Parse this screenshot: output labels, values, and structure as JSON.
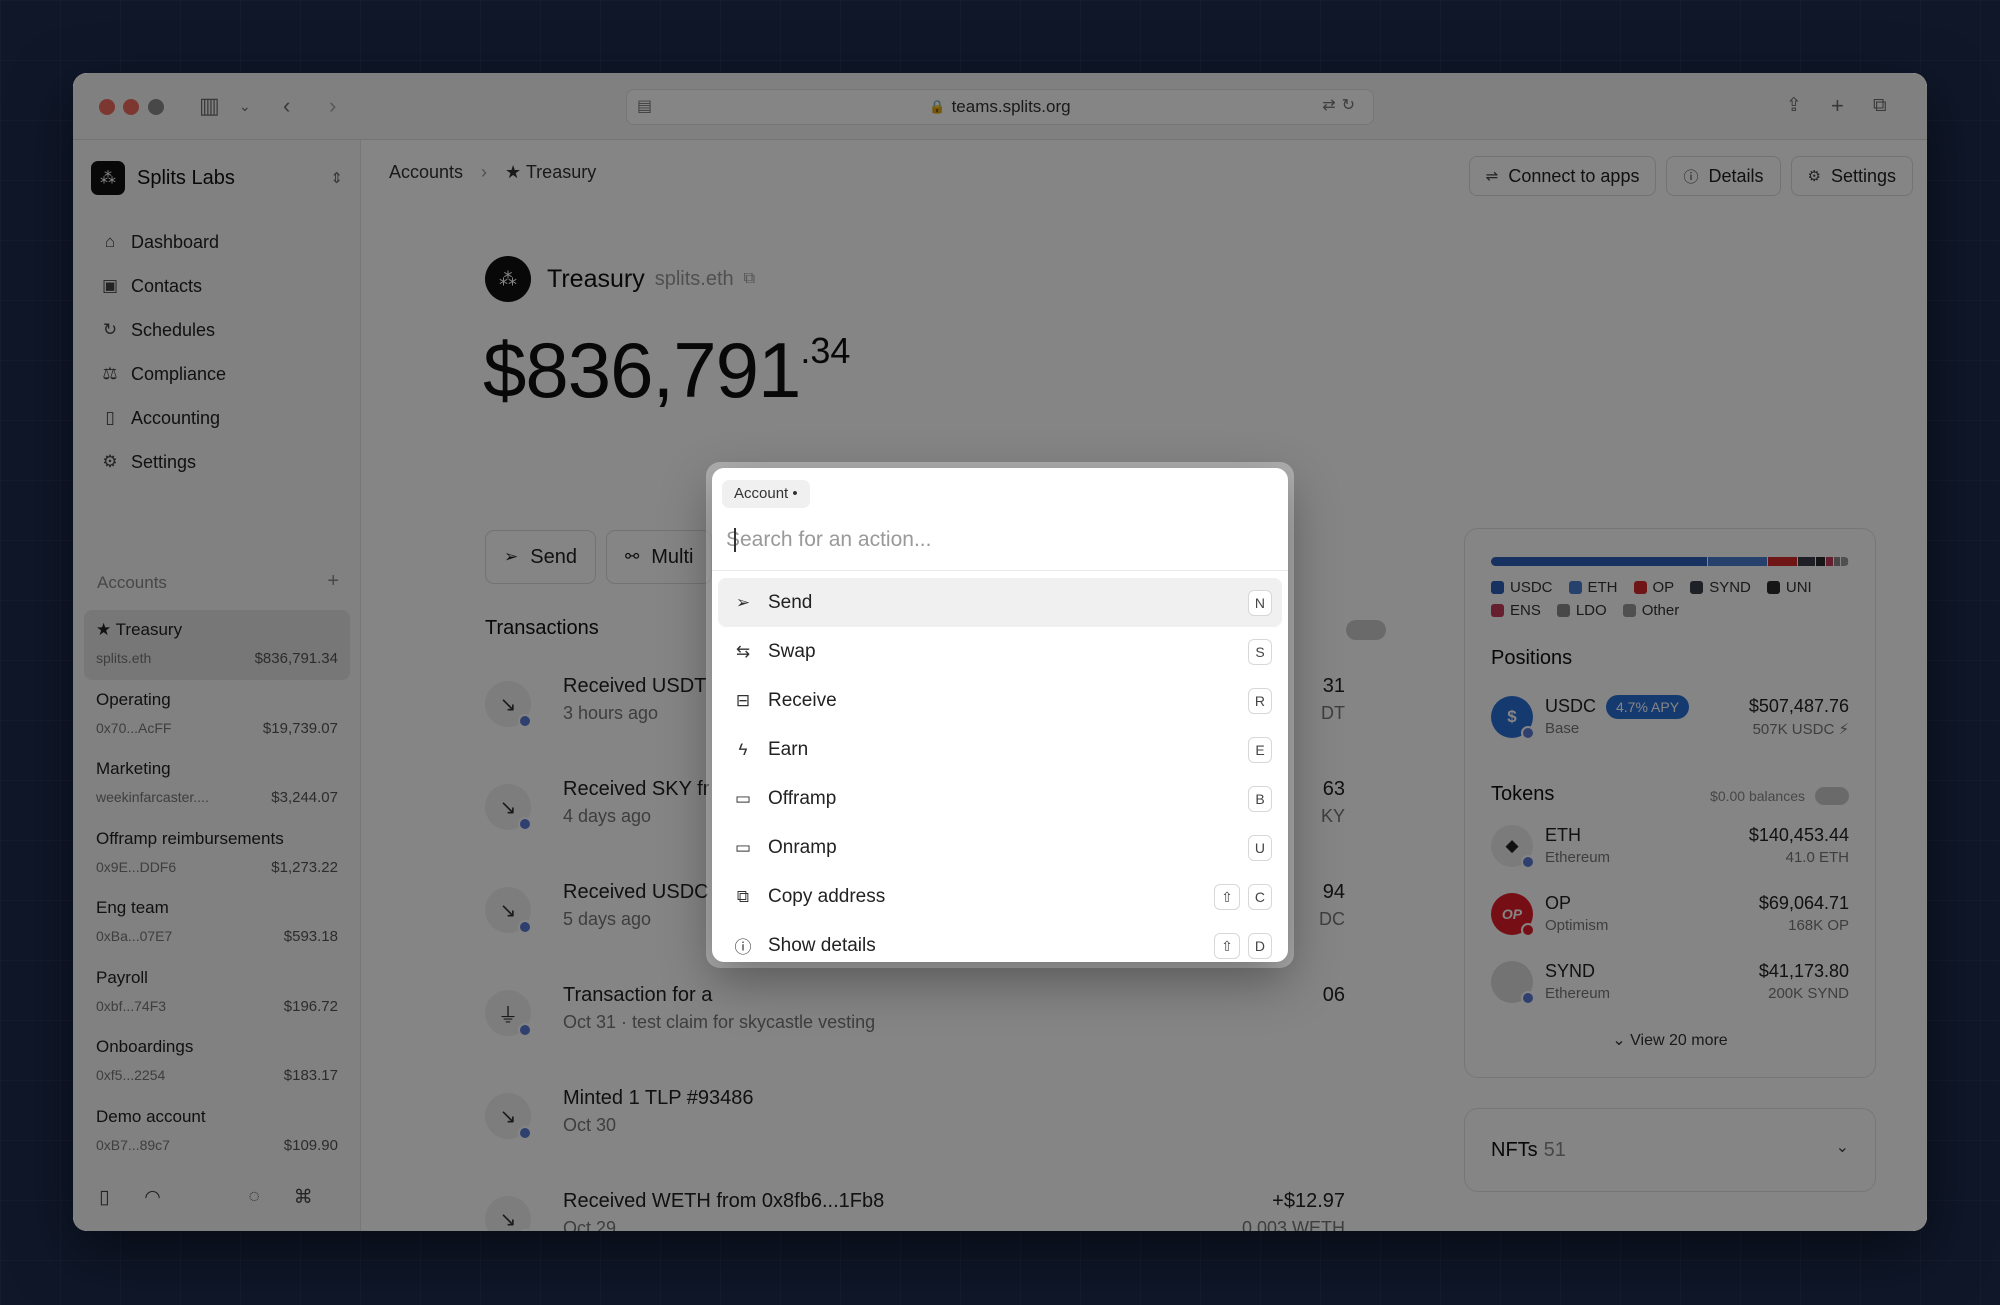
{
  "browser": {
    "url": "teams.splits.org"
  },
  "sidebar": {
    "org_name": "Splits Labs",
    "nav": [
      {
        "label": "Dashboard",
        "icon": "home-icon"
      },
      {
        "label": "Contacts",
        "icon": "contacts-icon"
      },
      {
        "label": "Schedules",
        "icon": "refresh-icon"
      },
      {
        "label": "Compliance",
        "icon": "scale-icon"
      },
      {
        "label": "Accounting",
        "icon": "book-icon"
      },
      {
        "label": "Settings",
        "icon": "gear-icon"
      }
    ],
    "accounts_heading": "Accounts",
    "accounts": [
      {
        "name": "★ Treasury",
        "sub": "splits.eth",
        "balance": "$836,791.34",
        "active": true
      },
      {
        "name": "Operating",
        "sub": "0x70...AcFF",
        "balance": "$19,739.07"
      },
      {
        "name": "Marketing",
        "sub": "weekinfarcaster....",
        "balance": "$3,244.07"
      },
      {
        "name": "Offramp reimbursements",
        "sub": "0x9E...DDF6",
        "balance": "$1,273.22"
      },
      {
        "name": "Eng team",
        "sub": "0xBa...07E7",
        "balance": "$593.18"
      },
      {
        "name": "Payroll",
        "sub": "0xbf...74F3",
        "balance": "$196.72"
      },
      {
        "name": "Onboardings",
        "sub": "0xf5...2254",
        "balance": "$183.17"
      },
      {
        "name": "Demo account",
        "sub": "0xB7...89c7",
        "balance": "$109.90"
      }
    ]
  },
  "header": {
    "crumb_root": "Accounts",
    "crumb_current": "★ Treasury",
    "connect_label": "Connect to apps",
    "details_label": "Details",
    "settings_label": "Settings"
  },
  "account": {
    "name": "Treasury",
    "ens": "splits.eth",
    "balance_whole": "$836,791",
    "balance_cents": ".34",
    "send_label": "Send",
    "multi_label": "Multi"
  },
  "transactions": {
    "title": "Transactions",
    "items": [
      {
        "title": "Received USDT",
        "sub": "3 hours ago",
        "amount": "31",
        "amount_sub": "DT",
        "icon": "arrow-down-right-icon"
      },
      {
        "title": "Received SKY fr",
        "sub": "4 days ago",
        "amount": "63",
        "amount_sub": "KY",
        "icon": "arrow-down-right-icon"
      },
      {
        "title": "Received USDC",
        "sub": "5 days ago",
        "amount": "94",
        "amount_sub": "DC",
        "icon": "arrow-down-right-icon"
      },
      {
        "title": "Transaction for a",
        "sub": "Oct 31 · test claim for skycastle vesting",
        "amount": "06",
        "amount_sub": "",
        "icon": "plug-icon"
      },
      {
        "title": "Minted 1 TLP #93486",
        "sub": "Oct 30",
        "amount": "",
        "amount_sub": "",
        "icon": "arrow-down-right-icon"
      },
      {
        "title": "Received WETH from 0x8fb6...1Fb8",
        "sub": "Oct 29",
        "amount": "+$12.97",
        "amount_sub": "0.003 WETH",
        "icon": "arrow-down-right-icon"
      }
    ]
  },
  "portfolio": {
    "allocation": [
      {
        "name": "USDC",
        "share": 0.607,
        "color": "#2d5fb8"
      },
      {
        "name": "ETH",
        "share": 0.168,
        "color": "#4a7fd0"
      },
      {
        "name": "OP",
        "share": 0.083,
        "color": "#d52a2a"
      },
      {
        "name": "SYND",
        "share": 0.049,
        "color": "#3a3f4a"
      },
      {
        "name": "UNI",
        "share": 0.03,
        "color": "#2b2b2b"
      },
      {
        "name": "ENS",
        "share": 0.022,
        "color": "#c43c5a"
      },
      {
        "name": "LDO",
        "share": 0.02,
        "color": "#8a8a8a"
      },
      {
        "name": "Other",
        "share": 0.021,
        "color": "#9a9a9a"
      }
    ],
    "positions_title": "Positions",
    "position": {
      "name": "USDC",
      "chain": "Base",
      "apy": "4.7% APY",
      "value": "$507,487.76",
      "amount": "507K USDC ⚡"
    },
    "tokens_title": "Tokens",
    "zero_balances_label": "$0.00 balances",
    "tokens": [
      {
        "name": "ETH",
        "chain": "Ethereum",
        "value": "$140,453.44",
        "amount": "41.0 ETH",
        "color": "#ececec",
        "glyph": "◆",
        "icon": "ethereum-icon"
      },
      {
        "name": "OP",
        "chain": "Optimism",
        "value": "$69,064.71",
        "amount": "168K OP",
        "color": "#e11d2a",
        "glyph": "OP",
        "icon": "optimism-icon"
      },
      {
        "name": "SYND",
        "chain": "Ethereum",
        "value": "$41,173.80",
        "amount": "200K SYND",
        "color": "#dcdcdc",
        "glyph": "",
        "icon": "synd-icon"
      }
    ],
    "view_more_label": "View 20 more",
    "nfts_label": "NFTs",
    "nfts_count": "51"
  },
  "command_palette": {
    "scope_chip": "Account •",
    "search_placeholder": "Search for an action...",
    "items": [
      {
        "label": "Send",
        "icon": "send-icon",
        "keys": [
          "N"
        ],
        "highlight": true
      },
      {
        "label": "Swap",
        "icon": "swap-icon",
        "keys": [
          "S"
        ]
      },
      {
        "label": "Receive",
        "icon": "inbox-icon",
        "keys": [
          "R"
        ]
      },
      {
        "label": "Earn",
        "icon": "bolt-icon",
        "keys": [
          "E"
        ]
      },
      {
        "label": "Offramp",
        "icon": "cash-out-icon",
        "keys": [
          "B"
        ]
      },
      {
        "label": "Onramp",
        "icon": "cash-in-icon",
        "keys": [
          "U"
        ]
      },
      {
        "label": "Copy address",
        "icon": "copy-icon",
        "keys": [
          "⇧",
          "C"
        ]
      },
      {
        "label": "Show details",
        "icon": "info-icon",
        "keys": [
          "⇧",
          "D"
        ]
      }
    ]
  }
}
